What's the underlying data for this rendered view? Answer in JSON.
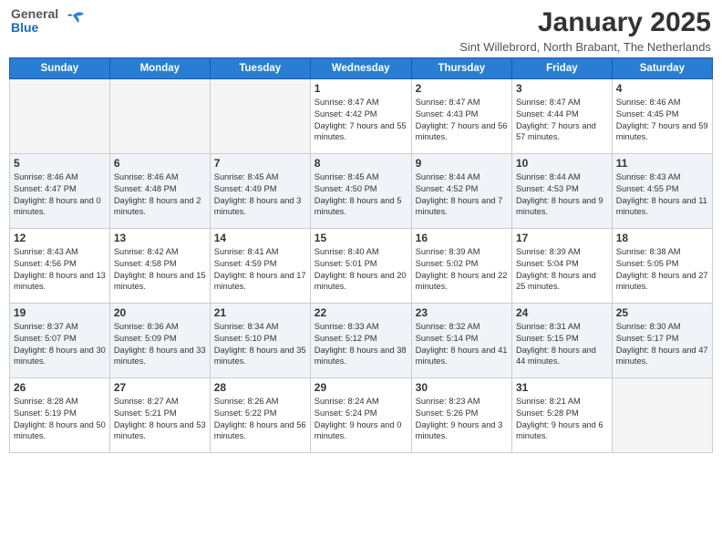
{
  "header": {
    "logo": {
      "general": "General",
      "blue": "Blue"
    },
    "title": "January 2025",
    "subtitle": "Sint Willebrord, North Brabant, The Netherlands"
  },
  "weekdays": [
    "Sunday",
    "Monday",
    "Tuesday",
    "Wednesday",
    "Thursday",
    "Friday",
    "Saturday"
  ],
  "weeks": [
    [
      {
        "num": "",
        "info": ""
      },
      {
        "num": "",
        "info": ""
      },
      {
        "num": "",
        "info": ""
      },
      {
        "num": "1",
        "info": "Sunrise: 8:47 AM\nSunset: 4:42 PM\nDaylight: 7 hours and 55 minutes."
      },
      {
        "num": "2",
        "info": "Sunrise: 8:47 AM\nSunset: 4:43 PM\nDaylight: 7 hours and 56 minutes."
      },
      {
        "num": "3",
        "info": "Sunrise: 8:47 AM\nSunset: 4:44 PM\nDaylight: 7 hours and 57 minutes."
      },
      {
        "num": "4",
        "info": "Sunrise: 8:46 AM\nSunset: 4:45 PM\nDaylight: 7 hours and 59 minutes."
      }
    ],
    [
      {
        "num": "5",
        "info": "Sunrise: 8:46 AM\nSunset: 4:47 PM\nDaylight: 8 hours and 0 minutes."
      },
      {
        "num": "6",
        "info": "Sunrise: 8:46 AM\nSunset: 4:48 PM\nDaylight: 8 hours and 2 minutes."
      },
      {
        "num": "7",
        "info": "Sunrise: 8:45 AM\nSunset: 4:49 PM\nDaylight: 8 hours and 3 minutes."
      },
      {
        "num": "8",
        "info": "Sunrise: 8:45 AM\nSunset: 4:50 PM\nDaylight: 8 hours and 5 minutes."
      },
      {
        "num": "9",
        "info": "Sunrise: 8:44 AM\nSunset: 4:52 PM\nDaylight: 8 hours and 7 minutes."
      },
      {
        "num": "10",
        "info": "Sunrise: 8:44 AM\nSunset: 4:53 PM\nDaylight: 8 hours and 9 minutes."
      },
      {
        "num": "11",
        "info": "Sunrise: 8:43 AM\nSunset: 4:55 PM\nDaylight: 8 hours and 11 minutes."
      }
    ],
    [
      {
        "num": "12",
        "info": "Sunrise: 8:43 AM\nSunset: 4:56 PM\nDaylight: 8 hours and 13 minutes."
      },
      {
        "num": "13",
        "info": "Sunrise: 8:42 AM\nSunset: 4:58 PM\nDaylight: 8 hours and 15 minutes."
      },
      {
        "num": "14",
        "info": "Sunrise: 8:41 AM\nSunset: 4:59 PM\nDaylight: 8 hours and 17 minutes."
      },
      {
        "num": "15",
        "info": "Sunrise: 8:40 AM\nSunset: 5:01 PM\nDaylight: 8 hours and 20 minutes."
      },
      {
        "num": "16",
        "info": "Sunrise: 8:39 AM\nSunset: 5:02 PM\nDaylight: 8 hours and 22 minutes."
      },
      {
        "num": "17",
        "info": "Sunrise: 8:39 AM\nSunset: 5:04 PM\nDaylight: 8 hours and 25 minutes."
      },
      {
        "num": "18",
        "info": "Sunrise: 8:38 AM\nSunset: 5:05 PM\nDaylight: 8 hours and 27 minutes."
      }
    ],
    [
      {
        "num": "19",
        "info": "Sunrise: 8:37 AM\nSunset: 5:07 PM\nDaylight: 8 hours and 30 minutes."
      },
      {
        "num": "20",
        "info": "Sunrise: 8:36 AM\nSunset: 5:09 PM\nDaylight: 8 hours and 33 minutes."
      },
      {
        "num": "21",
        "info": "Sunrise: 8:34 AM\nSunset: 5:10 PM\nDaylight: 8 hours and 35 minutes."
      },
      {
        "num": "22",
        "info": "Sunrise: 8:33 AM\nSunset: 5:12 PM\nDaylight: 8 hours and 38 minutes."
      },
      {
        "num": "23",
        "info": "Sunrise: 8:32 AM\nSunset: 5:14 PM\nDaylight: 8 hours and 41 minutes."
      },
      {
        "num": "24",
        "info": "Sunrise: 8:31 AM\nSunset: 5:15 PM\nDaylight: 8 hours and 44 minutes."
      },
      {
        "num": "25",
        "info": "Sunrise: 8:30 AM\nSunset: 5:17 PM\nDaylight: 8 hours and 47 minutes."
      }
    ],
    [
      {
        "num": "26",
        "info": "Sunrise: 8:28 AM\nSunset: 5:19 PM\nDaylight: 8 hours and 50 minutes."
      },
      {
        "num": "27",
        "info": "Sunrise: 8:27 AM\nSunset: 5:21 PM\nDaylight: 8 hours and 53 minutes."
      },
      {
        "num": "28",
        "info": "Sunrise: 8:26 AM\nSunset: 5:22 PM\nDaylight: 8 hours and 56 minutes."
      },
      {
        "num": "29",
        "info": "Sunrise: 8:24 AM\nSunset: 5:24 PM\nDaylight: 9 hours and 0 minutes."
      },
      {
        "num": "30",
        "info": "Sunrise: 8:23 AM\nSunset: 5:26 PM\nDaylight: 9 hours and 3 minutes."
      },
      {
        "num": "31",
        "info": "Sunrise: 8:21 AM\nSunset: 5:28 PM\nDaylight: 9 hours and 6 minutes."
      },
      {
        "num": "",
        "info": ""
      }
    ]
  ]
}
